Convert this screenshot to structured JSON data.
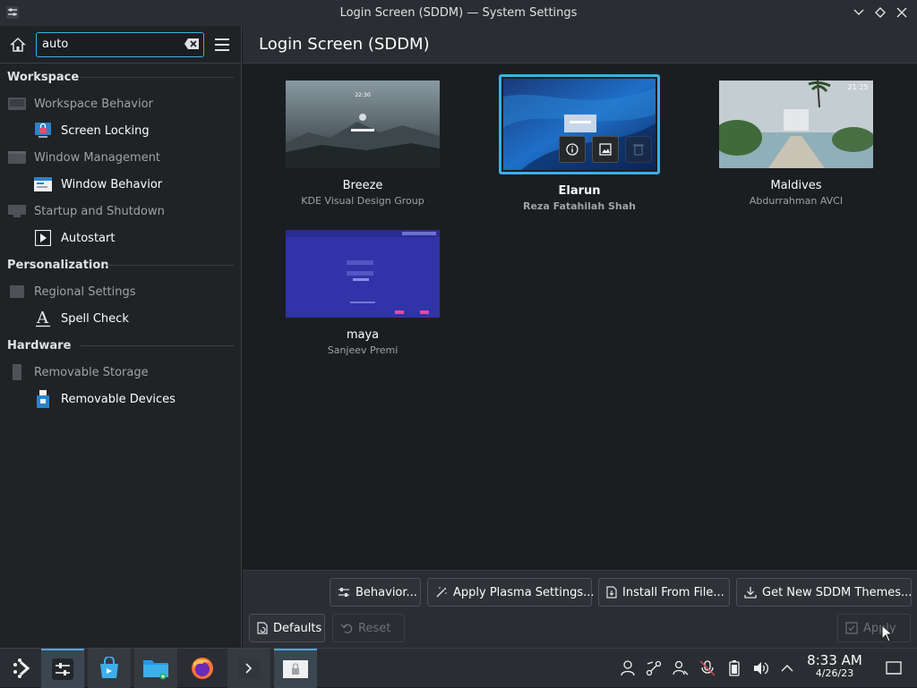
{
  "window": {
    "title": "Login Screen (SDDM) — System Settings"
  },
  "sidebar": {
    "search_value": "auto",
    "categories": [
      {
        "label": "Workspace",
        "groups": [
          {
            "label": "Workspace Behavior",
            "sub": "Screen Locking"
          },
          {
            "label": "Window Management",
            "sub": "Window Behavior"
          },
          {
            "label": "Startup and Shutdown",
            "sub": "Autostart"
          }
        ]
      },
      {
        "label": "Personalization",
        "groups": [
          {
            "label": "Regional Settings",
            "sub": "Spell Check"
          }
        ]
      },
      {
        "label": "Hardware",
        "groups": [
          {
            "label": "Removable Storage",
            "sub": "Removable Devices"
          }
        ]
      }
    ]
  },
  "main": {
    "title": "Login Screen (SDDM)",
    "themes": [
      {
        "name": "Breeze",
        "author": "KDE Visual Design Group",
        "selected": false,
        "thumb_time": "22:30"
      },
      {
        "name": "Elarun",
        "author": "Reza Fatahilah Shah",
        "selected": true
      },
      {
        "name": "Maldives",
        "author": "Abdurrahman AVCI",
        "selected": false,
        "thumb_time": "21:25"
      },
      {
        "name": "maya",
        "author": "Sanjeev Premi",
        "selected": false
      }
    ],
    "buttons": {
      "behavior": "Behavior...",
      "apply_plasma": "Apply Plasma Settings...",
      "install_file": "Install From File...",
      "get_new": "Get New SDDM Themes...",
      "defaults": "Defaults",
      "reset": "Reset",
      "apply": "Apply"
    }
  },
  "taskbar": {
    "time": "8:33 AM",
    "date": "4/26/23"
  },
  "colors": {
    "accent": "#3daee9",
    "bg": "#1b1e20",
    "panel": "#2a2e32"
  }
}
